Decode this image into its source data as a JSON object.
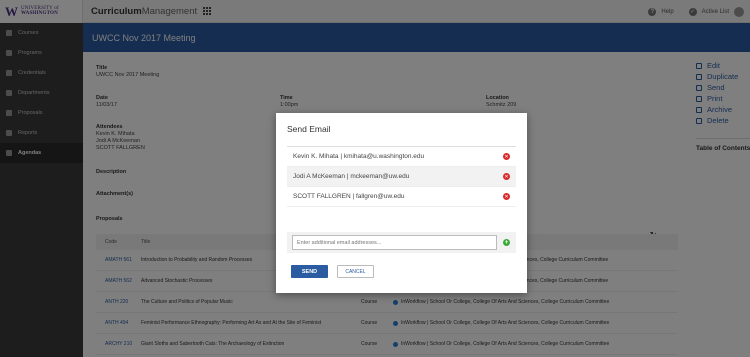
{
  "header": {
    "university_line1": "UNIVERSITY of",
    "university_line2": "WASHINGTON",
    "logo_letter": "W",
    "app_name_bold": "Curriculum",
    "app_name_light": "Management",
    "help_label": "Help",
    "active_list_label": "Active List"
  },
  "sidebar": {
    "items": [
      {
        "label": "Courses",
        "icon": "book-icon"
      },
      {
        "label": "Programs",
        "icon": "building-icon"
      },
      {
        "label": "Credentials",
        "icon": "certificate-icon"
      },
      {
        "label": "Departments",
        "icon": "pin-icon"
      },
      {
        "label": "Proposals",
        "icon": "document-icon"
      },
      {
        "label": "Reports",
        "icon": "chart-icon"
      },
      {
        "label": "Agendas",
        "icon": "agenda-icon"
      }
    ],
    "active_index": 6
  },
  "page": {
    "title": "UWCC Nov 2017 Meeting",
    "fields": {
      "title_label": "Title",
      "title_value": "UWCC Nov 2017 Meeting",
      "date_label": "Date",
      "date_value": "11/03/17",
      "time_label": "Time",
      "time_value": "1:00pm",
      "location_label": "Location",
      "location_value": "Schmitz 209",
      "attendees_label": "Attendees",
      "attendees": [
        "Kevin K. Mihata",
        "Jodi A McKeeman",
        "SCOTT FALLGREN"
      ],
      "description_label": "Description",
      "attachments_label": "Attachment(s)"
    },
    "proposals_label": "Proposals",
    "table_headers": {
      "code": "Code",
      "title": "Title"
    },
    "proposals": [
      {
        "code": "AMATH 561",
        "title": "Introduction to Probability and Random Processes",
        "type": "",
        "status": "Inworkflow | School Or College, College Of Arts And Sciences, College Curriculum Committee"
      },
      {
        "code": "AMATH 562",
        "title": "Advanced Stochastic Processes",
        "type": "",
        "status": "Inworkflow | School Or College, College Of Arts And Sciences, College Curriculum Committee"
      },
      {
        "code": "ANTH 220",
        "title": "The Culture and Politics of Popular Music",
        "type": "Course",
        "status": "InWorkflow | School Or College, College Of Arts And Sciences, College Curriculum Committee"
      },
      {
        "code": "ANTH 494",
        "title": "Feminist Performance Ethnography: Performing Art As and At the Site of Feminist",
        "type": "Course",
        "status": "InWorkflow | School Or College, College Of Arts And Sciences, College Curriculum Committee"
      },
      {
        "code": "ARCHY 210",
        "title": "Giant Sloths and Sabertooth Cats: The Archaeology of Extinction",
        "type": "Course",
        "status": "InWorkflow | School Or College, College Of Arts And Sciences, College Curriculum Committee"
      }
    ]
  },
  "actions": {
    "items": [
      {
        "label": "Edit",
        "icon": "edit-icon"
      },
      {
        "label": "Duplicate",
        "icon": "duplicate-icon"
      },
      {
        "label": "Send",
        "icon": "send-icon"
      },
      {
        "label": "Print",
        "icon": "print-icon"
      },
      {
        "label": "Archive",
        "icon": "archive-icon"
      },
      {
        "label": "Delete",
        "icon": "trash-icon"
      }
    ],
    "toc_label": "Table of Contents"
  },
  "modal": {
    "title": "Send Email",
    "recipients": [
      "Kevin K. Mihata | kmihata@u.washington.edu",
      "Jodi A McKeeman | mckeeman@uw.edu",
      "SCOTT FALLGREN | fallgren@uw.edu"
    ],
    "additional_placeholder": "Enter additional email addresses...",
    "send_label": "SEND",
    "cancel_label": "CANCEL"
  },
  "colors": {
    "brand_purple": "#4b2e83",
    "header_blue": "#2b5ba1",
    "sidebar_dark": "#3a3a3a",
    "remove_red": "#d92b2b",
    "add_green": "#3aa93a",
    "status_dot": "#2a7fd4"
  }
}
